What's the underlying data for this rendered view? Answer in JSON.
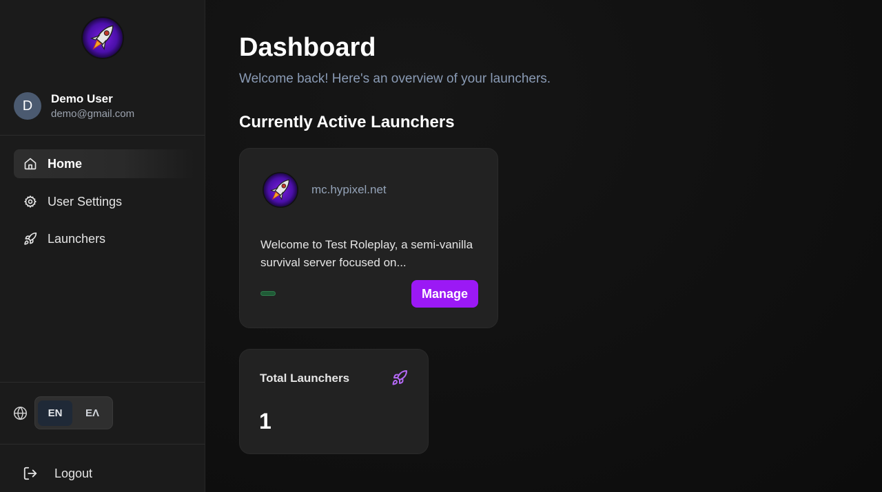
{
  "user": {
    "avatar_initial": "D",
    "name": "Demo User",
    "email": "demo@gmail.com"
  },
  "nav": {
    "items": [
      {
        "label": "Home",
        "icon": "home-icon",
        "active": true
      },
      {
        "label": "User Settings",
        "icon": "gear-icon",
        "active": false
      },
      {
        "label": "Launchers",
        "icon": "rocket-icon",
        "active": false
      }
    ]
  },
  "language": {
    "options": [
      "EN",
      "ΕΛ"
    ],
    "selected": "EN"
  },
  "logout_label": "Logout",
  "page": {
    "title": "Dashboard",
    "subtitle": "Welcome back! Here's an overview of your launchers.",
    "active_section_title": "Currently Active Launchers"
  },
  "launchers": [
    {
      "host": "mc.hypixel.net",
      "description": "Welcome to Test Roleplay, a semi-vanilla survival server focused on...",
      "manage_label": "Manage"
    }
  ],
  "stats": {
    "total_label": "Total Launchers",
    "total_value": "1"
  },
  "colors": {
    "accent": "#9b19f5",
    "sidebar_bg": "#1b1b1b",
    "card_bg": "#222222",
    "subtitle": "#8a9bb5",
    "status_ok": "#1f5a36"
  }
}
